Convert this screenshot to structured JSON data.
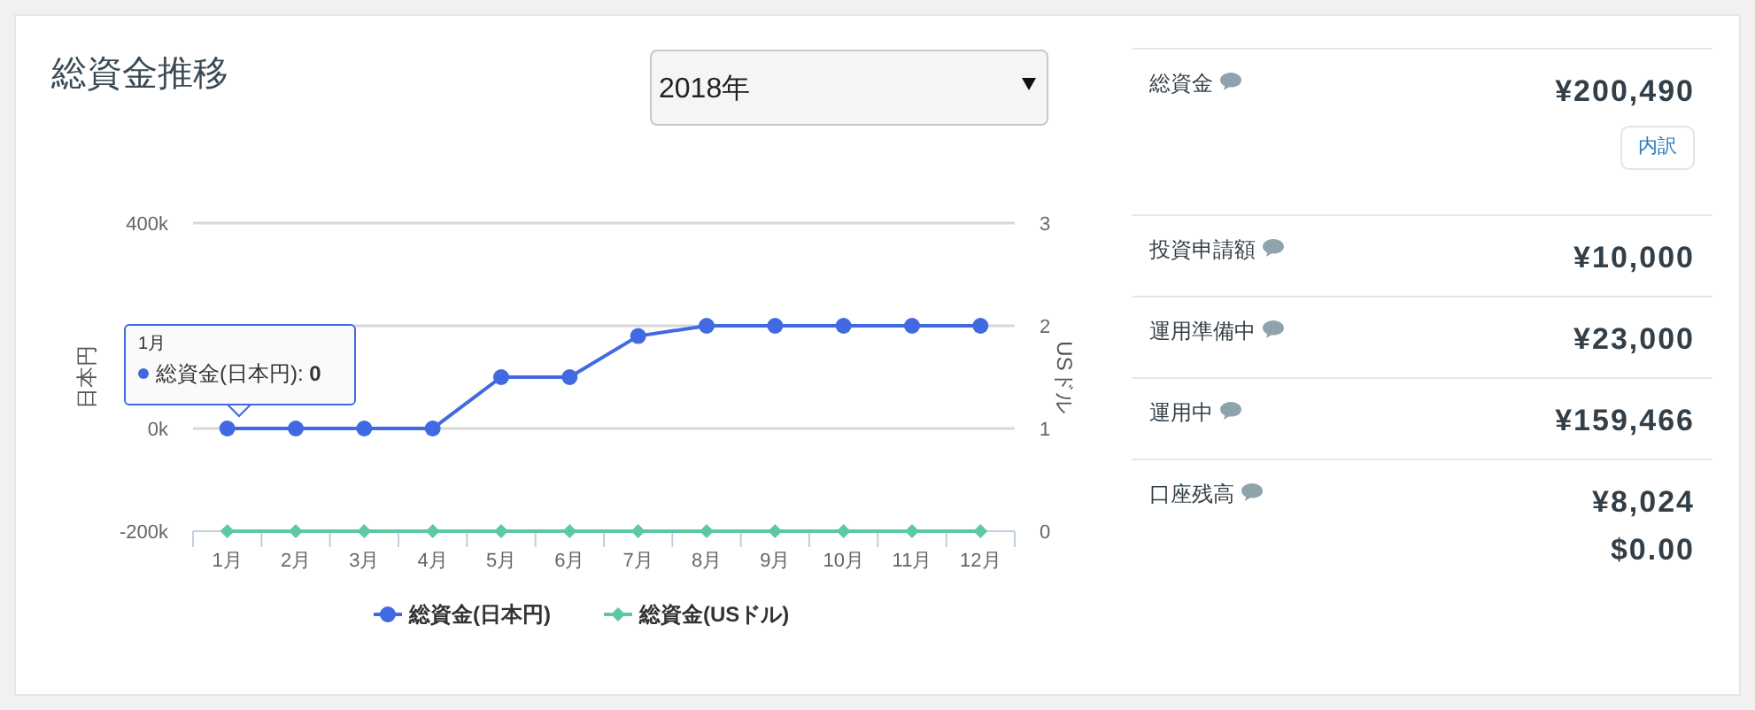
{
  "left_panel": {
    "title": "総資金推移",
    "year_select": {
      "value": "2018年"
    },
    "chart_data": {
      "type": "line",
      "categories": [
        "1月",
        "2月",
        "3月",
        "4月",
        "5月",
        "6月",
        "7月",
        "8月",
        "9月",
        "10月",
        "11月",
        "12月"
      ],
      "ylabel": "日本円",
      "ylim": [
        -200000,
        400000
      ],
      "yticks": [
        {
          "value": -200000,
          "label": "-200k"
        },
        {
          "value": 0,
          "label": "0k"
        },
        {
          "value": 400000,
          "label": "400k"
        }
      ],
      "y2label": "USドル",
      "legend": "bottom",
      "y2lim": [
        0,
        3
      ],
      "y2ticks": [
        0,
        1,
        2,
        3
      ],
      "series": [
        {
          "name": "総資金(日本円)",
          "color": "#4169e1",
          "axis": "y",
          "marker": "circle",
          "values": [
            0,
            0,
            0,
            0,
            100000,
            100000,
            180000,
            200000,
            200000,
            200000,
            200000,
            200000
          ]
        },
        {
          "name": "総資金(USドル)",
          "color": "#5cc9a0",
          "axis": "y2",
          "marker": "diamond",
          "values": [
            0,
            0,
            0,
            0,
            0,
            0,
            0,
            0,
            0,
            0,
            0,
            0
          ]
        }
      ]
    },
    "tooltip": {
      "title": "1月",
      "text": "総資金(日本円): **0**"
    }
  },
  "summary": [
    {
      "label": "総資金",
      "values": [
        "¥200,490"
      ],
      "button": "内訳"
    },
    {
      "label": "投資申請額",
      "values": [
        "¥10,000"
      ]
    },
    {
      "label": "運用準備中",
      "values": [
        "¥23,000"
      ]
    },
    {
      "label": "運用中",
      "values": [
        "¥159,466"
      ]
    },
    {
      "label": "口座残高",
      "values": [
        "¥8,024",
        "$0.00"
      ]
    }
  ]
}
